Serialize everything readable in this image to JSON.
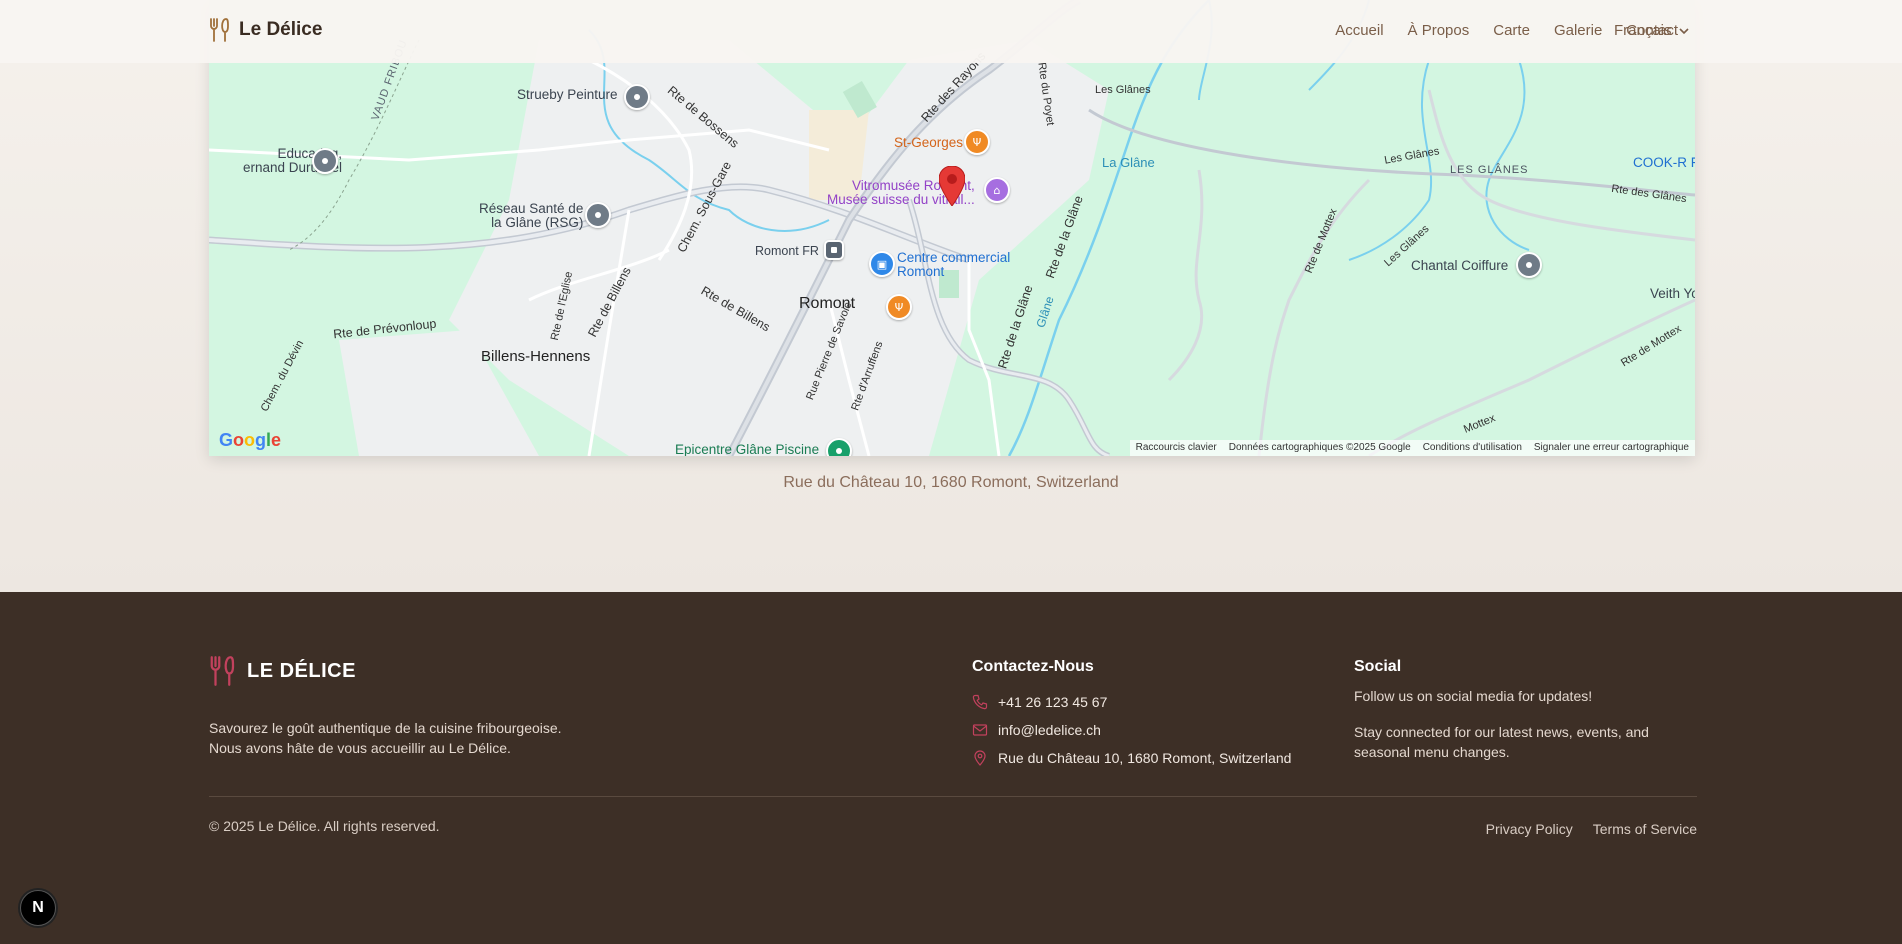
{
  "header": {
    "brand": "Le Délice",
    "nav": [
      "Accueil",
      "À Propos",
      "Carte",
      "Galerie",
      "Contact"
    ],
    "language": "Français"
  },
  "map": {
    "labels": {
      "strueby": "Strueby Peinture",
      "rte_bossens": "Rte de Bossens",
      "rte_rayons": "Rte des Rayons",
      "rte_poyet": "Rte du Poyet",
      "les_glanes_top": "Les Glânes",
      "la_glane": "La Glâne",
      "les_glanes_mid": "Les Glânes",
      "les_glanes_caps": "LES GLÂNES",
      "cook_r": "COOK-R Fo",
      "rte_des_glanes": "Rte des Glânes",
      "educadog_1": "Educadog,",
      "educadog_2": "ernand Durussel",
      "st_georges": "St-Georges",
      "vitromusee_1": "Vitromusée Romont,",
      "vitromusee_2": "Musée suisse du vitrail...",
      "reseau_1": "Réseau Santé de",
      "reseau_2": "la Glâne (RSG)",
      "chem_sous_gare": "Chem. Sous-Gare",
      "romont_fr": "Romont FR",
      "centre_1": "Centre commercial",
      "centre_2": "Romont",
      "rte_mottex": "Rte de Mottex",
      "les_glanes_right": "Les Glânes",
      "chantal": "Chantal Coiffure",
      "veith": "Veith Yo",
      "rte_eglise": "Rte de l'Eglise",
      "rte_billens_v": "Rte de Billens",
      "rte_billens_h": "Rte de Billens",
      "romont": "Romont",
      "rte_la_glane": "Rte de la Glâne",
      "rte_la_glane2": "Rte de la Glâne",
      "glane_river": "Glâne",
      "rte_prevonloup": "Rte de Prévonloup",
      "billens_hennens": "Billens-Hennens",
      "rte_savoie": "Rue Pierre de Savoie",
      "rte_arruffens": "Rte d'Arruffens",
      "chem_devin": "Chem. du Dévin",
      "epicentre": "Epicentre Glâne Piscine",
      "rte_mottex_br": "Rte de Mottex",
      "mottex_bottom": "Mottex",
      "vaud_fribourg": "VAUD FRIBOU"
    },
    "google": "Google",
    "attribution": [
      "Raccourcis clavier",
      "Données cartographiques ©2025 Google",
      "Conditions d'utilisation",
      "Signaler une erreur cartographique"
    ],
    "colors": {
      "land": "#d3f6e1",
      "urban": "#eef0f2",
      "road": "#ffffff",
      "water": "#7ad0ee",
      "pin": "#e53935"
    }
  },
  "address": "Rue du Château 10, 1680 Romont, Switzerland",
  "footer": {
    "brand": "LE DÉLICE",
    "desc1": "Savourez le goût authentique de la cuisine fribourgeoise.",
    "desc2": "Nous avons hâte de vous accueillir au Le Délice.",
    "contact_title": "Contactez-Nous",
    "phone": "+41 26 123 45 67",
    "email": "info@ledelice.ch",
    "address": "Rue du Château 10, 1680 Romont, Switzerland",
    "social_title": "Social",
    "social1": "Follow us on social media for updates!",
    "social2": "Stay connected for our latest news, events, and seasonal menu changes.",
    "copyright": "© 2025 Le Délice. All rights reserved.",
    "privacy": "Privacy Policy",
    "terms": "Terms of Service",
    "accent": "#c2415d"
  },
  "dev_badge": "N"
}
